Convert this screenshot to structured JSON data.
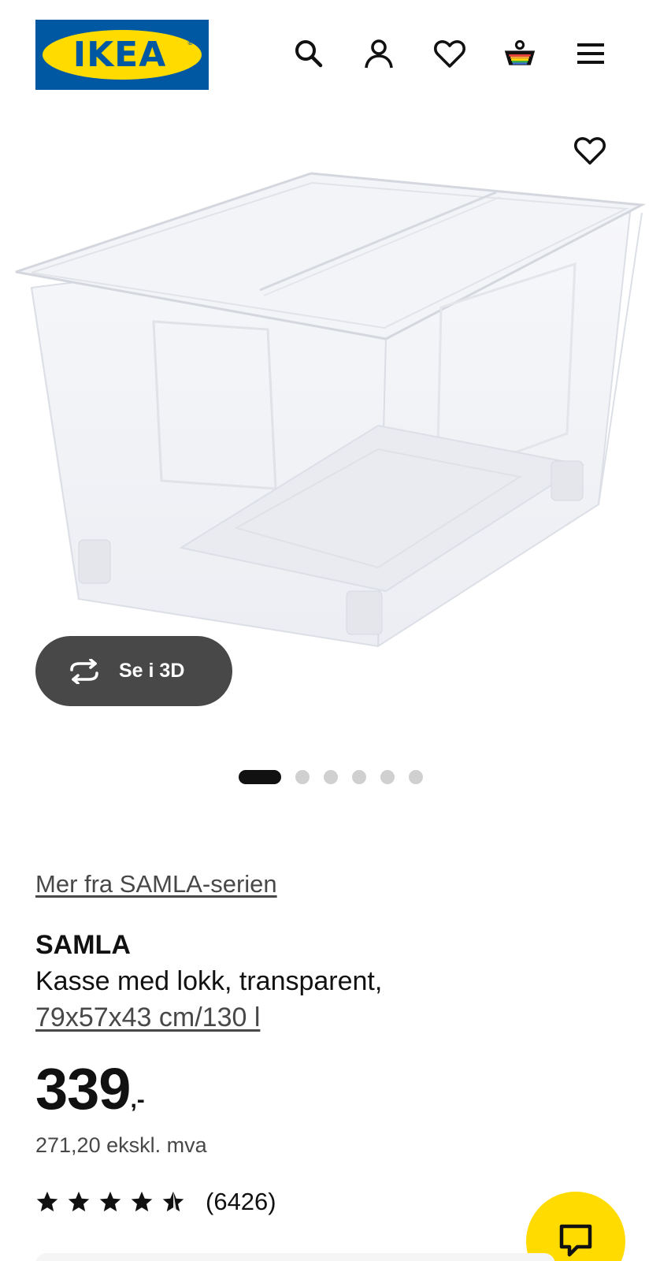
{
  "header": {
    "logo_text": "IKEA",
    "logo_reg": "®",
    "icons": [
      "search-icon",
      "account-icon",
      "favourites-icon",
      "cart-icon",
      "menu-icon"
    ],
    "colors": {
      "brand_blue": "#0058a3",
      "brand_yellow": "#ffdb00"
    }
  },
  "gallery": {
    "see_3d_label": "Se i 3D",
    "dot_count": 6,
    "active_dot": 0
  },
  "product": {
    "series_link": "Mer fra SAMLA-serien",
    "name": "SAMLA",
    "description": "Kasse med lokk, transparent,",
    "size": "79x57x43 cm/130 l",
    "price_integer": "339",
    "price_suffix": ",-",
    "price_ex_vat": "271,20 ekskl. mva",
    "rating_stars": 4.5,
    "rating_max": 5,
    "rating_count": "(6426)"
  },
  "chat": {
    "icon": "chat-icon",
    "color": "#ffdb00"
  }
}
